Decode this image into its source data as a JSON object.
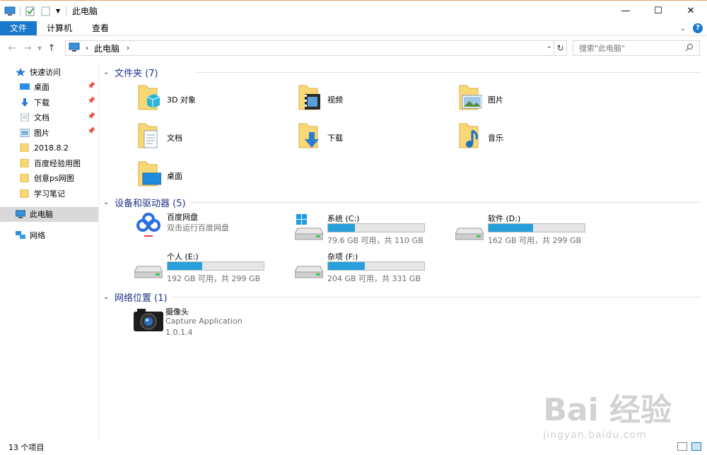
{
  "window": {
    "title": "此电脑"
  },
  "ribbon": {
    "tabs": [
      "文件",
      "计算机",
      "查看"
    ]
  },
  "address": {
    "crumb": "此电脑",
    "search_placeholder": "搜索\"此电脑\""
  },
  "sidebar": {
    "quick_access": "快速访问",
    "items": [
      {
        "label": "桌面",
        "pinned": true,
        "icon": "desktop-icon"
      },
      {
        "label": "下载",
        "pinned": true,
        "icon": "download-icon"
      },
      {
        "label": "文档",
        "pinned": true,
        "icon": "document-icon"
      },
      {
        "label": "图片",
        "pinned": true,
        "icon": "picture-icon"
      },
      {
        "label": "2018.8.2",
        "pinned": false,
        "icon": "folder-icon"
      },
      {
        "label": "百度经验用图",
        "pinned": false,
        "icon": "folder-icon"
      },
      {
        "label": "创意ps网图",
        "pinned": false,
        "icon": "folder-icon"
      },
      {
        "label": "学习笔记",
        "pinned": false,
        "icon": "folder-icon"
      }
    ],
    "this_pc": "此电脑",
    "network": "网络"
  },
  "sections": {
    "folders": {
      "label": "文件夹 (7)"
    },
    "devices": {
      "label": "设备和驱动器 (5)"
    },
    "network": {
      "label": "网络位置 (1)"
    }
  },
  "folders": [
    {
      "name": "3D 对象",
      "icon": "3d-objects-icon"
    },
    {
      "name": "视频",
      "icon": "videos-icon"
    },
    {
      "name": "图片",
      "icon": "pictures-icon"
    },
    {
      "name": "文档",
      "icon": "documents-icon"
    },
    {
      "name": "下载",
      "icon": "downloads-icon"
    },
    {
      "name": "音乐",
      "icon": "music-icon"
    },
    {
      "name": "桌面",
      "icon": "desktop-folder-icon"
    }
  ],
  "baidu_disk": {
    "name": "百度网盘",
    "sub": "双击运行百度网盘"
  },
  "drives": [
    {
      "name": "系统 (C:)",
      "info": "79.6 GB 可用，共 110 GB",
      "used_fraction": 0.28,
      "windows": true
    },
    {
      "name": "软件 (D:)",
      "info": "162 GB 可用，共 299 GB",
      "used_fraction": 0.46,
      "windows": false
    },
    {
      "name": "个人 (E:)",
      "info": "192 GB 可用，共 299 GB",
      "used_fraction": 0.36,
      "windows": false
    },
    {
      "name": "杂项 (F:)",
      "info": "204 GB 可用，共 331 GB",
      "used_fraction": 0.38,
      "windows": false
    }
  ],
  "network_item": {
    "name": "摄像头",
    "line2": "Capture Application",
    "line3": "1.0.1.4"
  },
  "status": {
    "count": "13 个项目"
  },
  "watermark": {
    "main": "Bai 经验",
    "sub": "jingyan.baidu.com"
  },
  "colors": {
    "accent": "#1979ca",
    "bar": "#26a0da",
    "section": "#1e3287",
    "folder": "#f8d775"
  }
}
